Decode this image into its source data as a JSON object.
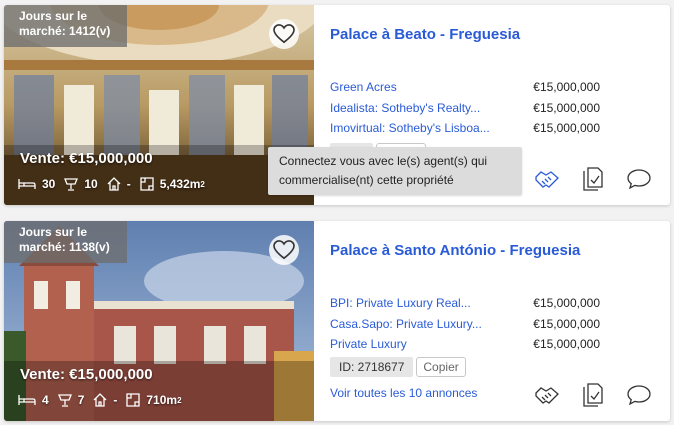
{
  "listings": [
    {
      "market_days": "Jours sur le marché: 1412(v)",
      "price_overlay": "Vente: €15,000,000",
      "bedrooms": "30",
      "bathrooms": "10",
      "floors": "-",
      "area": "5,432m",
      "area_unit_sup": "2",
      "title": "Palace à Beato - Freguesia",
      "agents": [
        {
          "name": "Green Acres",
          "price": "€15,000,000"
        },
        {
          "name": "Idealista: Sotheby's Realty...",
          "price": "€15,000,000"
        },
        {
          "name": "Imovirtual: Sotheby's Lisboa...",
          "price": "€15,000,000"
        }
      ],
      "id_label": "ID: 2",
      "copy_label": "Copier",
      "icons": {
        "favorite": "heart-icon",
        "contact": "handshake-icon",
        "document": "document-check-icon",
        "message": "chat-bubble-icon"
      }
    },
    {
      "market_days": "Jours sur le marché: 1138(v)",
      "price_overlay": "Vente: €15,000,000",
      "bedrooms": "4",
      "bathrooms": "7",
      "floors": "-",
      "area": "710m",
      "area_unit_sup": "2",
      "title": "Palace à Santo António - Freguesia",
      "agents": [
        {
          "name": "BPI: Private Luxury Real...",
          "price": "€15,000,000"
        },
        {
          "name": "Casa.Sapo: Private Luxury...",
          "price": "€15,000,000"
        },
        {
          "name": "Private Luxury",
          "price": "€15,000,000"
        }
      ],
      "id_label": "ID: 2718677",
      "copy_label": "Copier",
      "see_all": "Voir toutes les 10 annonces",
      "icons": {
        "favorite": "heart-icon",
        "contact": "handshake-icon",
        "document": "document-check-icon",
        "message": "chat-bubble-icon"
      }
    }
  ],
  "tooltip": "Connectez vous avec le(s) agent(s) qui commercialise(nt) cette propriété"
}
